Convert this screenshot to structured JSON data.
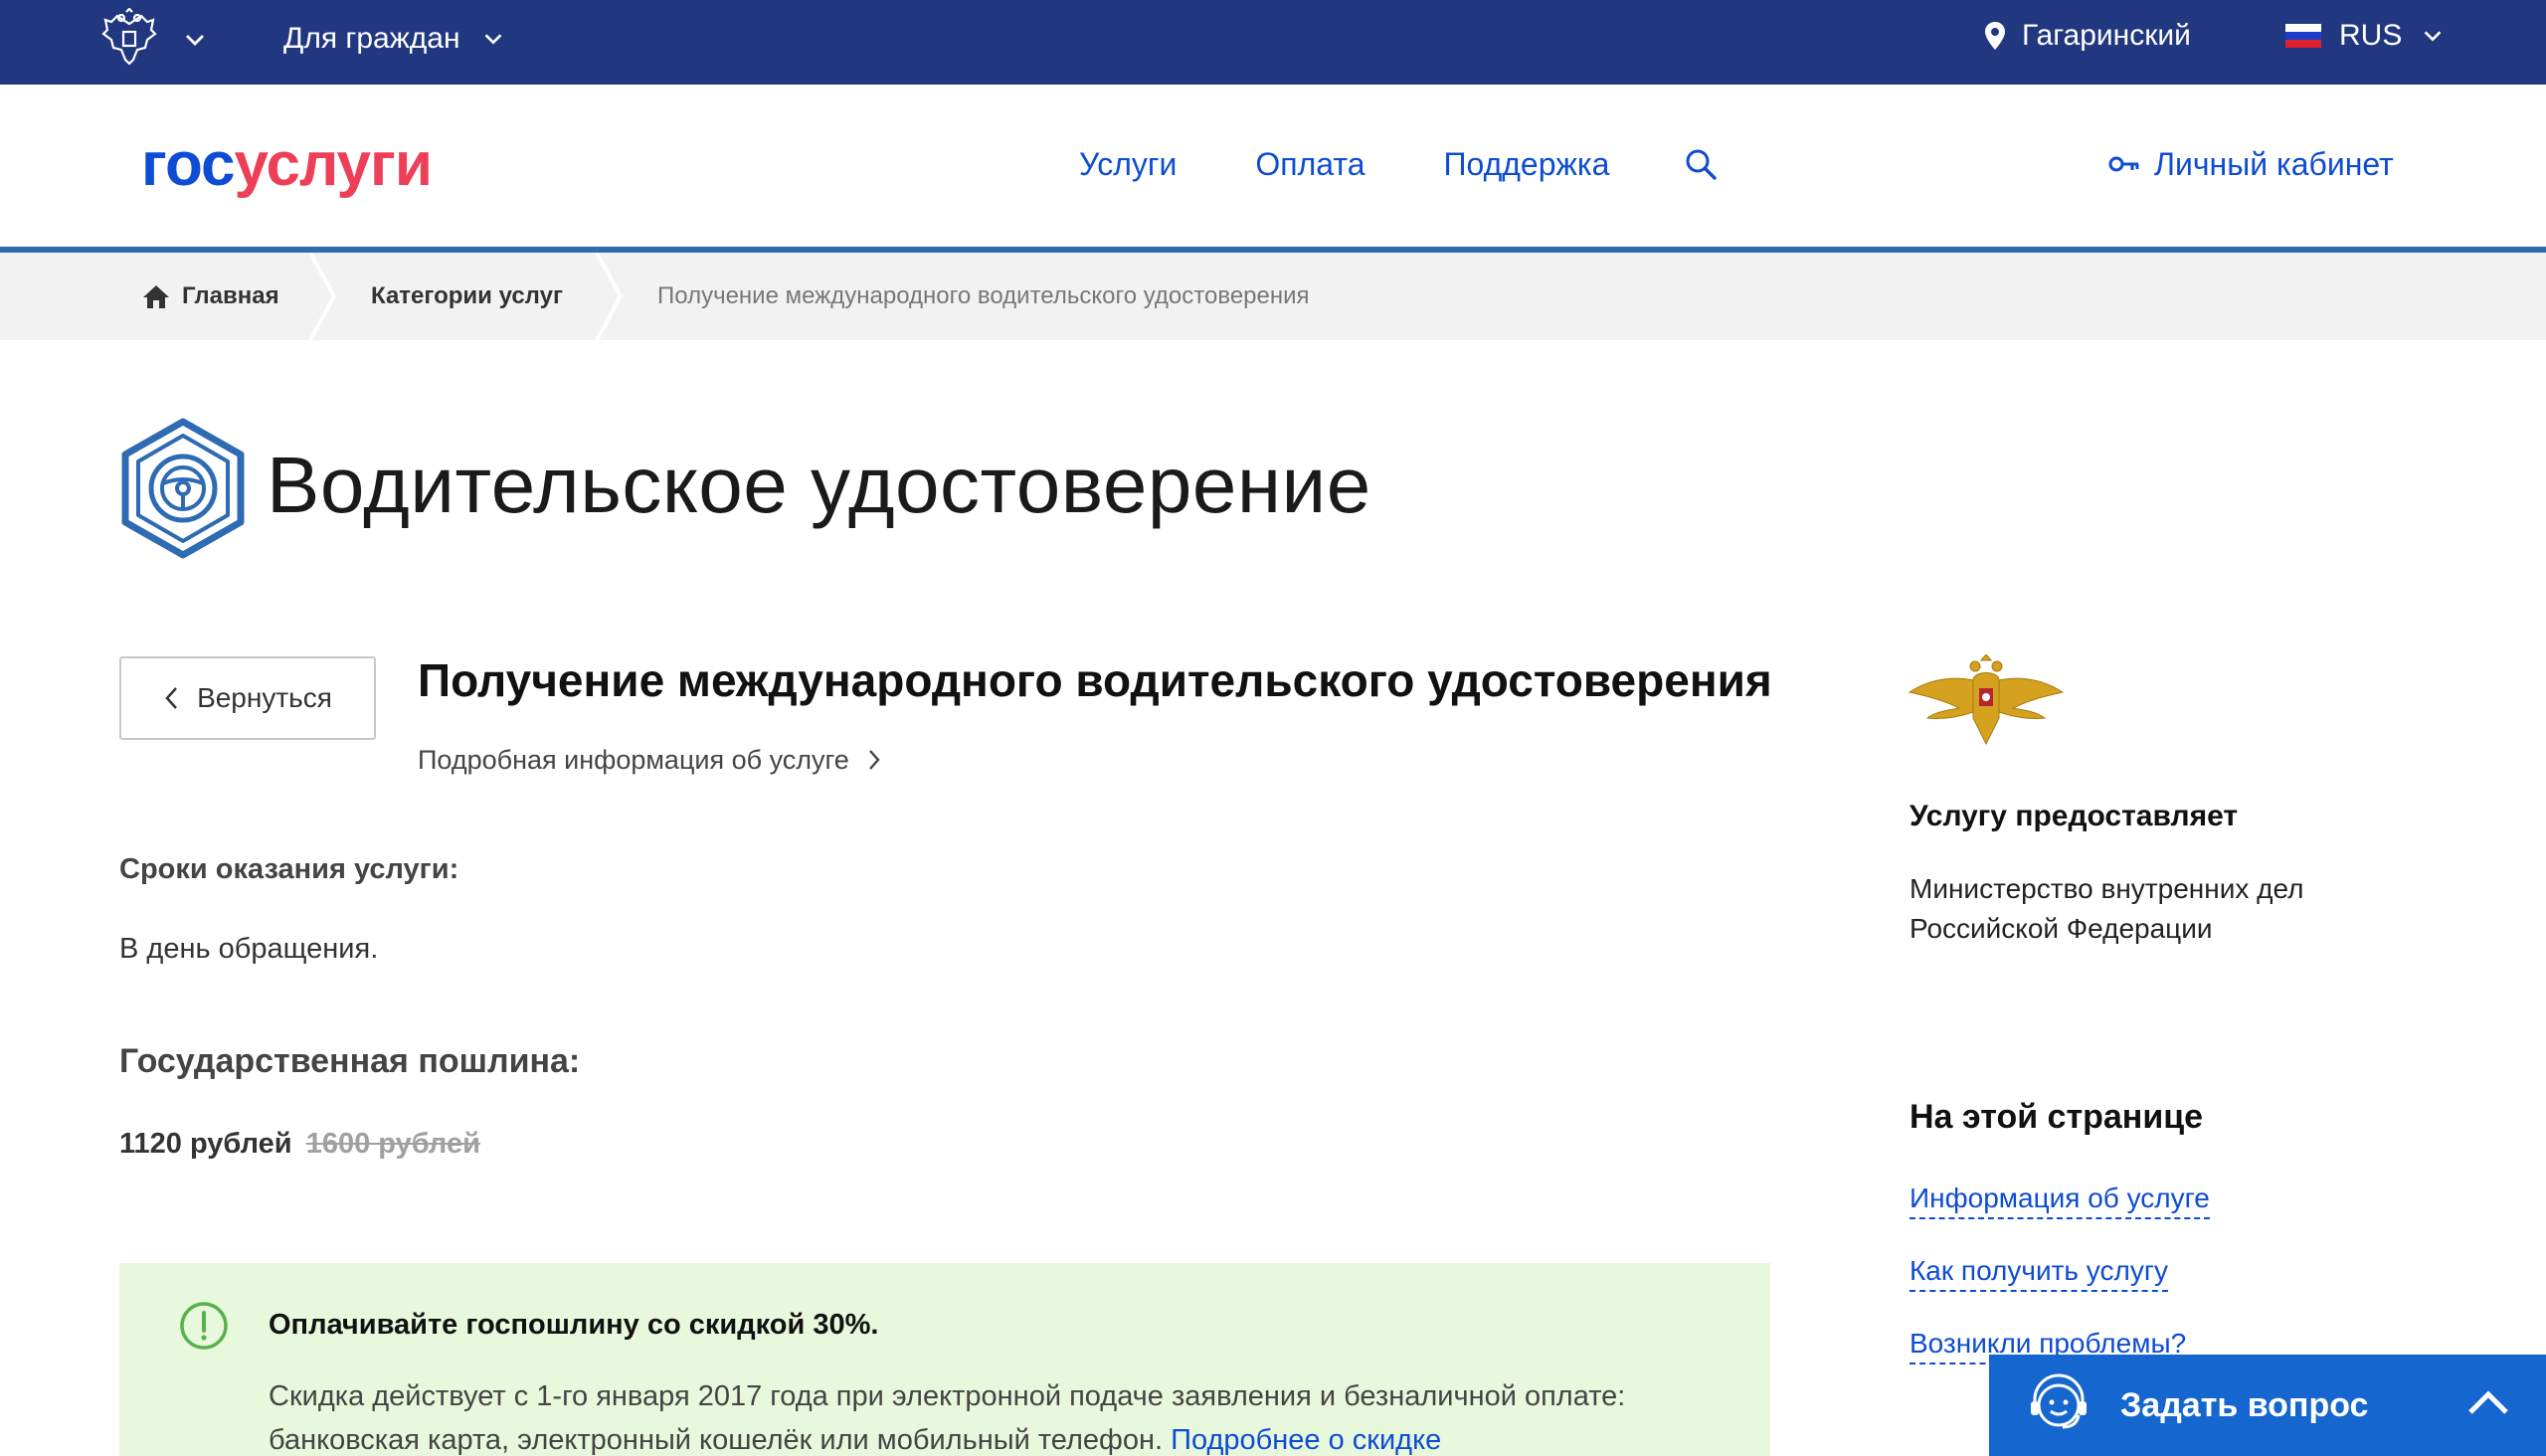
{
  "topbar": {
    "for_citizens": "Для граждан",
    "location": "Гагаринский",
    "language": "RUS"
  },
  "header": {
    "logo_part1": "гос",
    "logo_part2": "услуги",
    "nav": [
      "Услуги",
      "Оплата",
      "Поддержка"
    ],
    "cabinet": "Личный кабинет"
  },
  "breadcrumb": {
    "home": "Главная",
    "categories": "Категории услуг",
    "current": "Получение международного водительского удостоверения"
  },
  "page": {
    "title": "Водительское удостоверение",
    "back_label": "Вернуться",
    "service_title": "Получение международного водительского удостоверения",
    "service_more": "Подробная информация об услуге",
    "terms_label": "Сроки оказания услуги:",
    "terms_value": "В день обращения.",
    "fee_label": "Государственная пошлина:",
    "fee_current": "1120 рублей",
    "fee_old": "1600 рублей"
  },
  "promo": {
    "head": "Оплачивайте госпошлину со скидкой 30%.",
    "body": "Скидка действует с 1-го января 2017 года при электронной подаче заявления и безналичной оплате: банковская карта, электронный кошелёк или мобильный телефон.",
    "link": "Подробнее о скидке"
  },
  "sidebar": {
    "provider_label": "Услугу предоставляет",
    "provider_name": "Министерство внутренних дел Российской Федерации",
    "onpage_label": "На этой странице",
    "links": [
      "Информация об услуге",
      "Как получить услугу",
      "Возникли проблемы?"
    ]
  },
  "ask": {
    "label": "Задать вопрос"
  },
  "colors": {
    "topbar": "#213780",
    "brand_blue": "#0d4cd3",
    "brand_red": "#ee3f58",
    "promo_bg": "#e8f8dc",
    "ask_bg": "#1567cf"
  }
}
